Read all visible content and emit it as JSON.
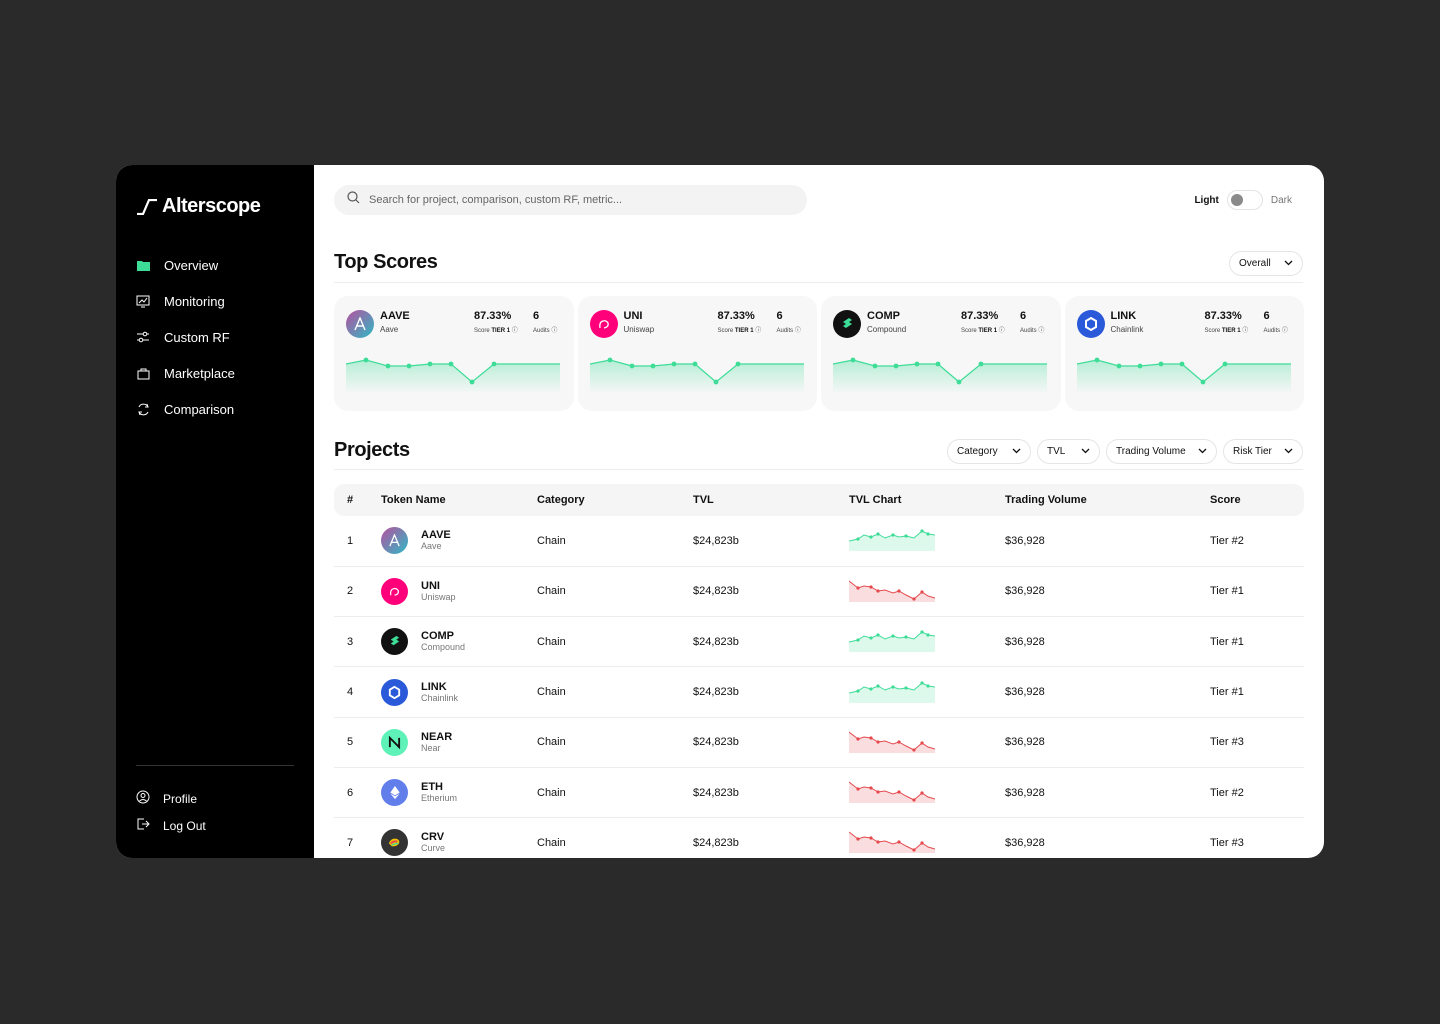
{
  "app": {
    "brand": "Alterscope"
  },
  "sidebar": {
    "items": [
      {
        "label": "Overview",
        "icon": "folder-icon",
        "active": true
      },
      {
        "label": "Monitoring",
        "icon": "monitor-chart-icon"
      },
      {
        "label": "Custom RF",
        "icon": "sliders-icon"
      },
      {
        "label": "Marketplace",
        "icon": "bag-icon"
      },
      {
        "label": "Comparison",
        "icon": "compare-icon"
      }
    ],
    "bottom": [
      {
        "label": "Profile",
        "icon": "user-icon"
      },
      {
        "label": "Log Out",
        "icon": "logout-icon"
      }
    ]
  },
  "search": {
    "placeholder": "Search for project, comparison, custom RF, metric..."
  },
  "theme": {
    "light": "Light",
    "dark": "Dark",
    "active": "light"
  },
  "top_scores": {
    "title": "Top Scores",
    "filter": "Overall",
    "cards": [
      {
        "symbol": "AAVE",
        "name": "Aave",
        "score": "87.33%",
        "score_label": "Score",
        "tier": "TIER 1",
        "audits": "6",
        "audits_label": "Audits",
        "icon_color": "#b6509e"
      },
      {
        "symbol": "UNI",
        "name": "Uniswap",
        "score": "87.33%",
        "score_label": "Score",
        "tier": "TIER 1",
        "audits": "6",
        "audits_label": "Audits",
        "icon_color": "#ff007a"
      },
      {
        "symbol": "COMP",
        "name": "Compound",
        "score": "87.33%",
        "score_label": "Score",
        "tier": "TIER 1",
        "audits": "6",
        "audits_label": "Audits",
        "icon_color": "#111111"
      },
      {
        "symbol": "LINK",
        "name": "Chainlink",
        "score": "87.33%",
        "score_label": "Score",
        "tier": "TIER 1",
        "audits": "6",
        "audits_label": "Audits",
        "icon_color": "#2a5ada"
      }
    ]
  },
  "projects": {
    "title": "Projects",
    "filters": [
      "Category",
      "TVL",
      "Trading Volume",
      "Risk Tier"
    ],
    "columns": [
      "#",
      "Token Name",
      "Category",
      "TVL",
      "TVL Chart",
      "Trading Volume",
      "Score"
    ],
    "rows": [
      {
        "rank": "1",
        "symbol": "AAVE",
        "name": "Aave",
        "category": "Chain",
        "tvl": "$24,823b",
        "trend": "up",
        "volume": "$36,928",
        "score": "Tier #2",
        "icon_color": "#b6509e"
      },
      {
        "rank": "2",
        "symbol": "UNI",
        "name": "Uniswap",
        "category": "Chain",
        "tvl": "$24,823b",
        "trend": "down",
        "volume": "$36,928",
        "score": "Tier #1",
        "icon_color": "#ff007a"
      },
      {
        "rank": "3",
        "symbol": "COMP",
        "name": "Compound",
        "category": "Chain",
        "tvl": "$24,823b",
        "trend": "up",
        "volume": "$36,928",
        "score": "Tier #1",
        "icon_color": "#111111"
      },
      {
        "rank": "4",
        "symbol": "LINK",
        "name": "Chainlink",
        "category": "Chain",
        "tvl": "$24,823b",
        "trend": "up",
        "volume": "$36,928",
        "score": "Tier #1",
        "icon_color": "#2a5ada"
      },
      {
        "rank": "5",
        "symbol": "NEAR",
        "name": "Near",
        "category": "Chain",
        "tvl": "$24,823b",
        "trend": "down",
        "volume": "$36,928",
        "score": "Tier #3",
        "icon_color": "#5ef2b8"
      },
      {
        "rank": "6",
        "symbol": "ETH",
        "name": "Etherium",
        "category": "Chain",
        "tvl": "$24,823b",
        "trend": "down",
        "volume": "$36,928",
        "score": "Tier #2",
        "icon_color": "#627eea"
      },
      {
        "rank": "7",
        "symbol": "CRV",
        "name": "Curve",
        "category": "Chain",
        "tvl": "$24,823b",
        "trend": "down",
        "volume": "$36,928",
        "score": "Tier #3",
        "icon_color": "#333333"
      }
    ]
  },
  "colors": {
    "positive": "#3ddc97",
    "negative": "#e5484d",
    "accent": "#3ddc97"
  }
}
